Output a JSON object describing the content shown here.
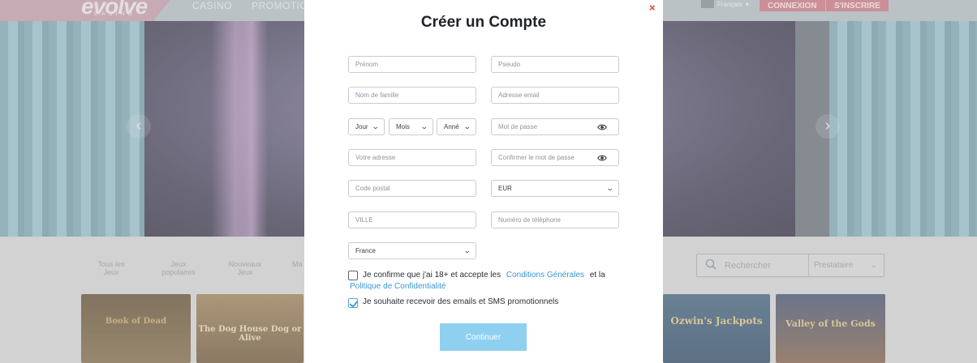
{
  "site": {
    "logo": "evolve",
    "logo_sub": "CASINO",
    "nav": [
      "CASINO",
      "PROMOTIONS"
    ],
    "language": "Français",
    "login_label": "CONNEXION",
    "register_label": "S'INSCRIRE",
    "categories": [
      "Tous les Jeux",
      "Jeux populaires",
      "Nouveaux Jeux",
      "Ma"
    ],
    "search_placeholder": "Rechercher",
    "provider_label": "Prestataire",
    "tiles": [
      "Book of Dead",
      "The Dog House Dog or Alive",
      "Ozwin's Jackpots",
      "Valley of the Gods"
    ]
  },
  "modal": {
    "close_symbol": "×",
    "title": "Créer un Compte",
    "fields": {
      "first_name": "Prénom",
      "username": "Pseudo",
      "last_name": "Nom de famille",
      "email": "Adresse email",
      "day": "Jour",
      "month": "Mois",
      "year": "Anné",
      "password": "Mot de passe",
      "address": "Votre adresse",
      "confirm_password": "Confirmer le mot de passe",
      "postal_code": "Code postal",
      "currency": "EUR",
      "city": "VILLE",
      "phone": "Numéro de téléphone",
      "country": "France"
    },
    "terms": {
      "text_before": "Je confirme que j'ai 18+ et accepte les",
      "link_terms": "Conditions Générales",
      "text_and": "et la",
      "link_privacy": "Politique de Confidentialité",
      "checked": false
    },
    "promo": {
      "text": "Je souhaite recevoir des emails et SMS promotionnels",
      "checked": true
    },
    "submit_label": "Continuer"
  },
  "colors": {
    "accent": "#3b97cf",
    "submit": "#8fd0f0",
    "close": "#e0413b"
  }
}
